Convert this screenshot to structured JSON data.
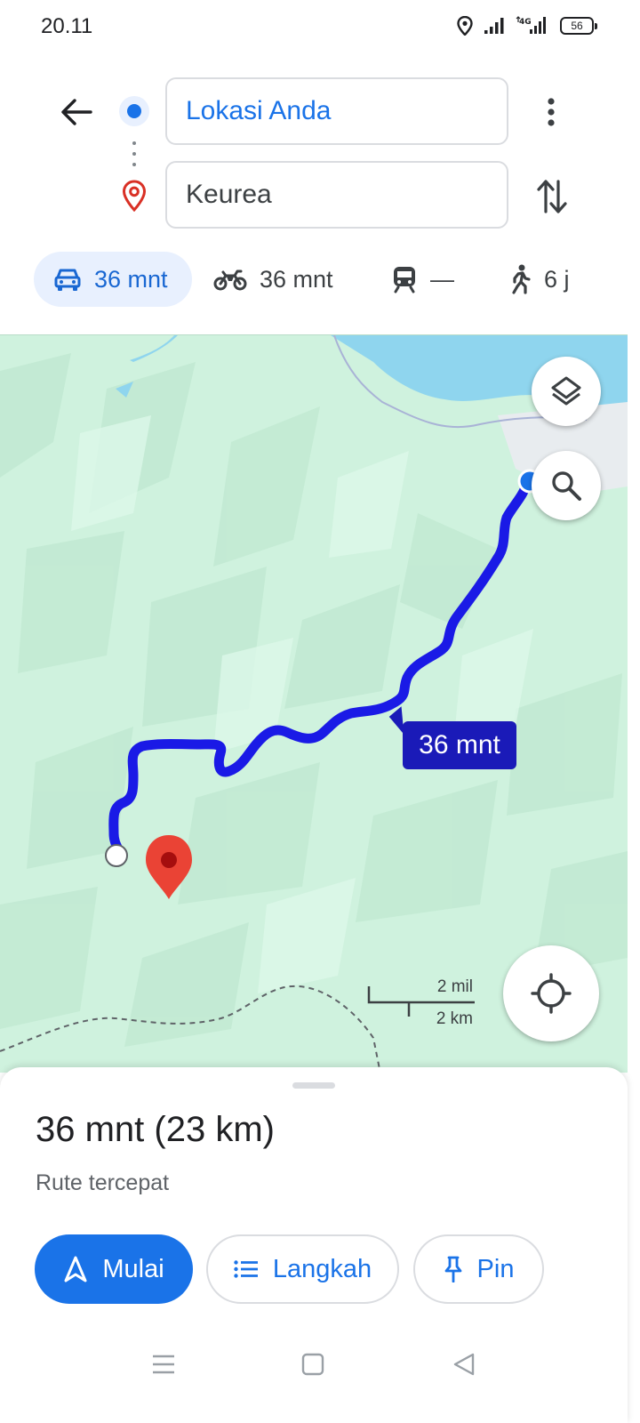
{
  "status_bar": {
    "time": "20.11",
    "battery": "56",
    "network": "4G"
  },
  "directions": {
    "origin": "Lokasi Anda",
    "destination": "Keurea"
  },
  "modes": [
    {
      "name": "car",
      "label": "36 mnt",
      "selected": true
    },
    {
      "name": "motorcycle",
      "label": "36 mnt",
      "selected": false
    },
    {
      "name": "transit",
      "label": "—",
      "selected": false
    },
    {
      "name": "walk",
      "label": "6 j",
      "selected": false
    }
  ],
  "map": {
    "route_label": "36 mnt",
    "scale_imperial": "2 mil",
    "scale_metric": "2 km",
    "route_color": "#1a1ae6"
  },
  "summary": {
    "title": "36 mnt (23 km)",
    "subtitle": "Rute tercepat"
  },
  "actions": {
    "start": "Mulai",
    "steps": "Langkah",
    "pin": "Pin"
  },
  "colors": {
    "accent": "#1a73e8",
    "map_land": "#cff2de",
    "water": "#8fd5ee",
    "pin": "#ea4335"
  }
}
